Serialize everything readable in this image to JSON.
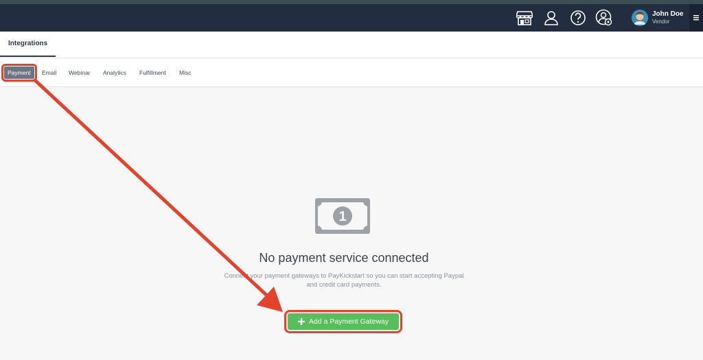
{
  "header": {
    "icons": [
      "store-icon",
      "user-icon",
      "help-icon",
      "account-settings-icon"
    ],
    "user": {
      "name": "John Doe",
      "role": "Vendor"
    }
  },
  "page": {
    "title": "Integrations"
  },
  "subnav": {
    "tabs": [
      {
        "label": "Payment",
        "active": true
      },
      {
        "label": "Email"
      },
      {
        "label": "Webinar"
      },
      {
        "label": "Analytics"
      },
      {
        "label": "Fulfillment"
      },
      {
        "label": "Misc"
      }
    ]
  },
  "empty": {
    "icon": "money-bill-icon",
    "bill_digit": "1",
    "title": "No payment service connected",
    "desc_line1": "Connect your payment gateways to PayKickstart so you can start accepting Paypal",
    "desc_line2": "and credit card payments.",
    "button_label": "Add a Payment Gateway"
  },
  "colors": {
    "header_bg": "#222d3f",
    "accent_green": "#58bd5b",
    "annotation_red": "#e4432b"
  }
}
